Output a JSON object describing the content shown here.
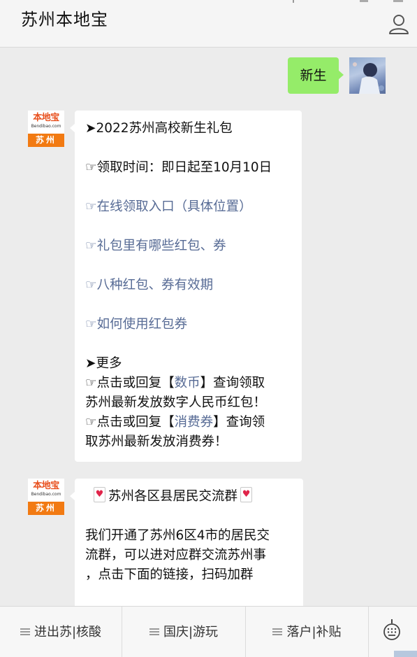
{
  "header": {
    "title": "苏州本地宝",
    "profile_icon": "person-icon"
  },
  "conversation": {
    "user_message": "新生",
    "brand_avatar": {
      "logo_text": "本地宝",
      "logo_subtext": "Bendibao.com",
      "city": "苏州"
    },
    "reply_1": {
      "title": "➤2022苏州高校新生礼包",
      "time": "☞领取时间：即日起至10月10日",
      "links": [
        "☞在线领取入口（具体位置）",
        "☞礼包里有哪些红包、券",
        "☞八种红包、券有效期",
        "☞如何使用红包券"
      ],
      "more_label": "➤更多",
      "line_1_prefix": "☞点击或回复【",
      "line_1_keyword": "数币",
      "line_1_suffix": "】查询领取",
      "line_2": "苏州最新发放数字人民币红包！",
      "line_3_prefix": "☞点击或回复【",
      "line_3_keyword": "消费券",
      "line_3_suffix": "】查询领",
      "line_4": "取苏州最新发放消费券！"
    },
    "reply_2": {
      "title": "苏州各区县居民交流群",
      "body_lines": [
        "我们开通了苏州6区4市的居民交",
        "流群，可以进对应群交流苏州事",
        "，点击下面的链接，扫码加群"
      ]
    }
  },
  "bottom_menu": {
    "items": [
      "进出苏|核酸",
      "国庆|游玩",
      "落户|补贴"
    ],
    "keyboard_icon": "keyboard-icon"
  },
  "colors": {
    "user_bubble": "#95ec69",
    "link": "#576b95",
    "brand_orange": "#f27a12"
  }
}
